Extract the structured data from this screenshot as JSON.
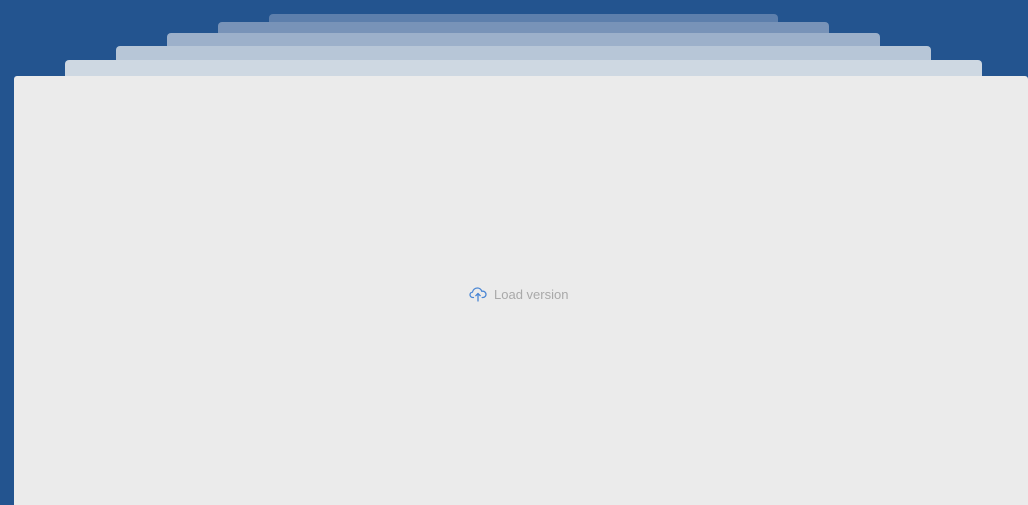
{
  "version_stack": {
    "layer_count": 5,
    "background_color": "#23548f",
    "panel_color": "#ebebeb"
  },
  "load_action": {
    "label": "Load version",
    "icon": "cloud-upload-icon",
    "icon_color": "#4a86d4",
    "text_color": "#a9a9a9"
  }
}
